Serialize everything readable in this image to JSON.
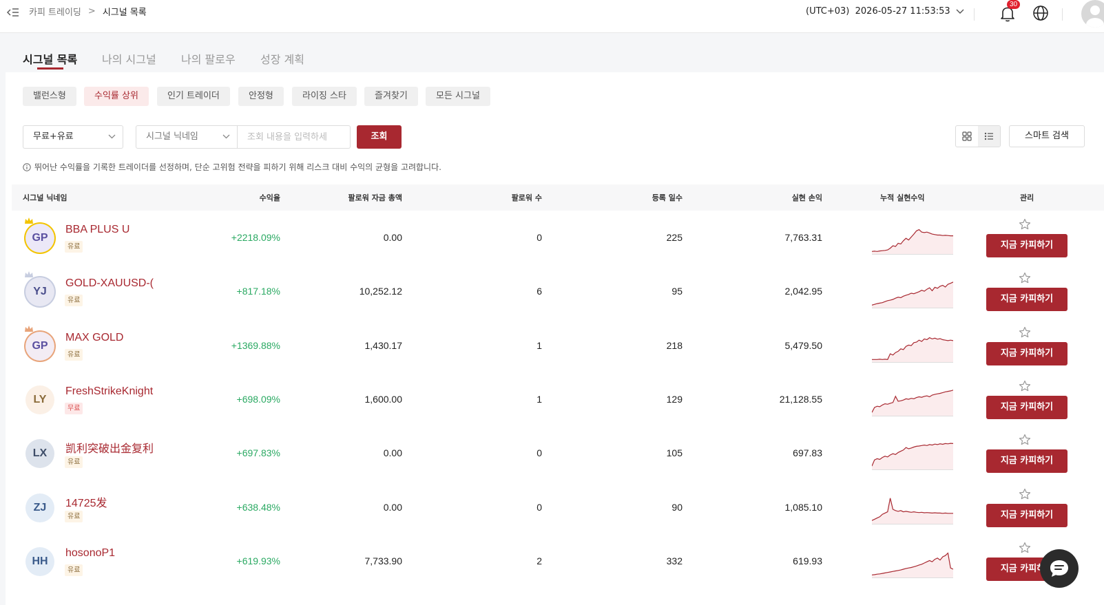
{
  "header": {
    "breadcrumb_parent": "카피 트레이딩",
    "breadcrumb_sep": ">",
    "breadcrumb_current": "시그널 목록",
    "timezone": "(UTC+03)",
    "datetime": "2026-05-27 11:53:53",
    "notification_count": "30"
  },
  "tabs": [
    {
      "label": "시그널 목록",
      "active": true
    },
    {
      "label": "나의 시그널",
      "active": false
    },
    {
      "label": "나의 팔로우",
      "active": false
    },
    {
      "label": "성장 계획",
      "active": false
    }
  ],
  "chips": [
    {
      "label": "밸런스형",
      "active": false
    },
    {
      "label": "수익률 상위",
      "active": true
    },
    {
      "label": "인기 트레이더",
      "active": false
    },
    {
      "label": "안정형",
      "active": false
    },
    {
      "label": "라이징 스타",
      "active": false
    },
    {
      "label": "즐겨찾기",
      "active": false
    },
    {
      "label": "모든 시그널",
      "active": false
    }
  ],
  "filters": {
    "fee_type": "무료+유료",
    "field_select": "시그널 닉네임",
    "query_placeholder": "조회 내용을 입력하세",
    "search_label": "조회",
    "smart_search_label": "스마트 검색"
  },
  "info_text": "뛰어난 수익률을 기록한 트레이더를 선정하며, 단순 고위험 전략을 피하기 위해 리스크 대비 수익의 균형을 고려합니다.",
  "table": {
    "columns": [
      "시그널 닉네임",
      "수익율",
      "팔로워 자금 총액",
      "팔로워 수",
      "등록 일수",
      "실현 손익",
      "누적 실현수익",
      "관리"
    ],
    "copy_label": "지금 카피하기",
    "rows": [
      {
        "initials": "GP",
        "avatar_bg": "#ece8f8",
        "avatar_fg": "#5a4fa0",
        "ring": "#f3c400",
        "crown": "#f3c400",
        "nickname": "BBA PLUS U",
        "tag": "유료",
        "tag_type": "paid",
        "return": "+2218.09%",
        "follower_funds": "0.00",
        "followers": "0",
        "days": "225",
        "pnl": "7,763.31",
        "spark": [
          0.02,
          0.03,
          0.02,
          0.04,
          0.05,
          0.06,
          0.08,
          0.15,
          0.25,
          0.22,
          0.35,
          0.32,
          0.45,
          0.55,
          0.48,
          0.6,
          0.72,
          0.85,
          0.9,
          0.8,
          0.78,
          0.8,
          0.76,
          0.72,
          0.7,
          0.68,
          0.68,
          0.66,
          0.67,
          0.66,
          0.65,
          0.65
        ]
      },
      {
        "initials": "YJ",
        "avatar_bg": "#e8e8f3",
        "avatar_fg": "#4a4e8c",
        "ring": "#c7cde0",
        "crown": "#c7cde0",
        "nickname": "GOLD-XAUUSD-(",
        "tag": "유료",
        "tag_type": "paid",
        "return": "+817.18%",
        "follower_funds": "10,252.12",
        "followers": "6",
        "days": "95",
        "pnl": "2,042.95",
        "spark": [
          0.02,
          0.05,
          0.08,
          0.1,
          0.12,
          0.16,
          0.2,
          0.22,
          0.25,
          0.3,
          0.34,
          0.32,
          0.38,
          0.42,
          0.45,
          0.5,
          0.48,
          0.52,
          0.56,
          0.62,
          0.58,
          0.66,
          0.72,
          0.6,
          0.74,
          0.7,
          0.78,
          0.82,
          0.75,
          0.86,
          0.9,
          0.95
        ]
      },
      {
        "initials": "GP",
        "avatar_bg": "#f3ecf4",
        "avatar_fg": "#5a4fa0",
        "ring": "#e8a47a",
        "crown": "#e8a47a",
        "nickname": "MAX GOLD",
        "tag": "유료",
        "tag_type": "paid",
        "return": "+1369.88%",
        "follower_funds": "1,430.17",
        "followers": "1",
        "days": "218",
        "pnl": "5,479.50",
        "spark": [
          0.02,
          0.02,
          0.02,
          0.03,
          0.02,
          0.03,
          0.02,
          0.25,
          0.2,
          0.3,
          0.35,
          0.45,
          0.42,
          0.55,
          0.6,
          0.58,
          0.7,
          0.72,
          0.8,
          0.75,
          0.85,
          0.82,
          0.9,
          0.85,
          0.88,
          0.84,
          0.86,
          0.82,
          0.8,
          0.78,
          0.8,
          0.78
        ]
      },
      {
        "initials": "LY",
        "avatar_bg": "#fbf0e6",
        "avatar_fg": "#8a6b3a",
        "ring": "none",
        "crown": "",
        "nickname": "FreshStrikeKnight",
        "tag": "무료",
        "tag_type": "free",
        "return": "+698.09%",
        "follower_funds": "1,600.00",
        "followers": "1",
        "days": "129",
        "pnl": "21,128.55",
        "spark": [
          0.05,
          0.25,
          0.3,
          0.28,
          0.35,
          0.4,
          0.38,
          0.42,
          0.45,
          0.7,
          0.5,
          0.52,
          0.55,
          0.6,
          0.58,
          0.62,
          0.6,
          0.65,
          0.68,
          0.66,
          0.7,
          0.72,
          0.68,
          0.75,
          0.78,
          0.8,
          0.82,
          0.85,
          0.88,
          0.9,
          0.92,
          0.95
        ]
      },
      {
        "initials": "LX",
        "avatar_bg": "#dde3ec",
        "avatar_fg": "#3e4d68",
        "ring": "none",
        "crown": "",
        "nickname": "凯利突破出金复利",
        "tag": "유료",
        "tag_type": "paid",
        "return": "+697.83%",
        "follower_funds": "0.00",
        "followers": "0",
        "days": "105",
        "pnl": "697.83",
        "spark": [
          0.05,
          0.3,
          0.35,
          0.32,
          0.4,
          0.45,
          0.42,
          0.5,
          0.55,
          0.52,
          0.6,
          0.65,
          0.7,
          0.8,
          0.75,
          0.78,
          0.82,
          0.85,
          0.86,
          0.88,
          0.9,
          0.88,
          0.92,
          0.9,
          0.94,
          0.92,
          0.95,
          0.93,
          0.96,
          0.95,
          0.97,
          0.96
        ]
      },
      {
        "initials": "ZJ",
        "avatar_bg": "#e3ecf6",
        "avatar_fg": "#3a5a8a",
        "ring": "none",
        "crown": "",
        "nickname": "14725发",
        "tag": "유료",
        "tag_type": "paid",
        "return": "+638.48%",
        "follower_funds": "0.00",
        "followers": "0",
        "days": "90",
        "pnl": "1,085.10",
        "spark": [
          0.05,
          0.1,
          0.15,
          0.2,
          0.3,
          0.35,
          0.4,
          0.95,
          0.5,
          0.45,
          0.42,
          0.45,
          0.4,
          0.42,
          0.4,
          0.38,
          0.4,
          0.38,
          0.37,
          0.38,
          0.36,
          0.37,
          0.36,
          0.35,
          0.36,
          0.35,
          0.35,
          0.34,
          0.35,
          0.34,
          0.34,
          0.34
        ]
      },
      {
        "initials": "HH",
        "avatar_bg": "#e3ecf6",
        "avatar_fg": "#3a5a8a",
        "ring": "none",
        "crown": "",
        "nickname": "hosonoP1",
        "tag": "유료",
        "tag_type": "paid",
        "return": "+619.93%",
        "follower_funds": "7,733.90",
        "followers": "2",
        "days": "332",
        "pnl": "619.93",
        "spark": [
          0.02,
          0.03,
          0.05,
          0.06,
          0.08,
          0.1,
          0.12,
          0.14,
          0.16,
          0.18,
          0.2,
          0.22,
          0.25,
          0.28,
          0.3,
          0.32,
          0.35,
          0.38,
          0.42,
          0.45,
          0.5,
          0.55,
          0.6,
          0.55,
          0.65,
          0.7,
          0.62,
          0.75,
          0.8,
          0.9,
          0.3,
          0.25
        ]
      }
    ]
  },
  "colors": {
    "accent": "#a82830",
    "positive": "#2aa962"
  }
}
